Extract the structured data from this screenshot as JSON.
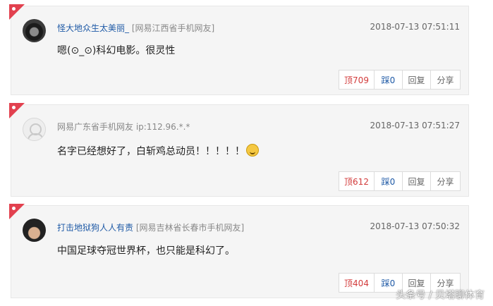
{
  "comments": [
    {
      "username": "怪大地众生太美丽_",
      "location": "[网易江西省手机网友]",
      "time": "2018-07-13 07:51:11",
      "text": "嗯(⊙_⊙)科幻电影。很灵性",
      "up": "顶709",
      "down": "踩0",
      "reply": "回复",
      "share": "分享"
    },
    {
      "username": "",
      "location": "网易广东省手机网友 ip:112.96.*.*",
      "time": "2018-07-13 07:51:27",
      "text": "名字已经想好了，白斩鸡总动员！！！！！",
      "up": "顶612",
      "down": "踩0",
      "reply": "回复",
      "share": "分享"
    },
    {
      "username": "打击地狱狗人人有责",
      "location": "[网易吉林省长春市手机网友]",
      "time": "2018-07-13 07:50:32",
      "text": "中国足球夺冠世界杯，也只能是科幻了。",
      "up": "顶404",
      "down": "踩0",
      "reply": "回复",
      "share": "分享"
    }
  ],
  "watermark": "头条号 / 贝塔聊体育",
  "icons": {
    "flag": "red-corner-flag-icon",
    "emoji": "dizzy-face-emoji-icon"
  },
  "colors": {
    "username": "#1f5aa6",
    "up": "#d23b3b",
    "flag": "#e2414f"
  }
}
